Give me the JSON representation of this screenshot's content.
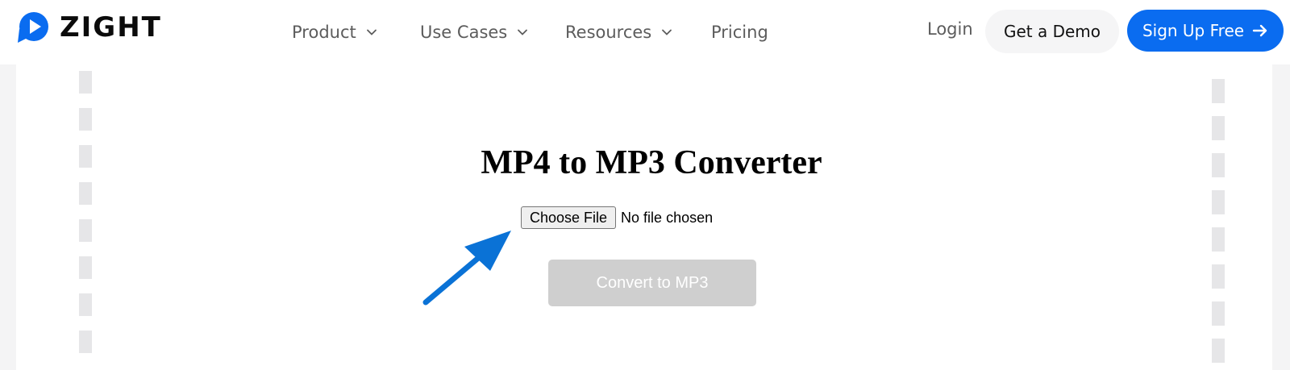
{
  "brand": {
    "name": "ZIGHT",
    "color": "#0a6cf0"
  },
  "nav": {
    "items": [
      {
        "label": "Product",
        "has_dropdown": true
      },
      {
        "label": "Use Cases",
        "has_dropdown": true
      },
      {
        "label": "Resources",
        "has_dropdown": true
      },
      {
        "label": "Pricing",
        "has_dropdown": false
      }
    ],
    "login_label": "Login",
    "demo_label": "Get a Demo",
    "signup_label": "Sign Up Free"
  },
  "converter": {
    "title": "MP4 to MP3 Converter",
    "choose_file_label": "Choose File",
    "file_status": "No file chosen",
    "convert_label": "Convert to MP3",
    "convert_enabled": false
  },
  "colors": {
    "accent": "#0a6cf0",
    "annotation_arrow": "#0a72d6",
    "disabled_button": "#cfcfcf"
  },
  "icons": [
    "zight-logo-icon",
    "chevron-down-icon",
    "arrow-right-icon",
    "annotation-arrow-icon"
  ]
}
